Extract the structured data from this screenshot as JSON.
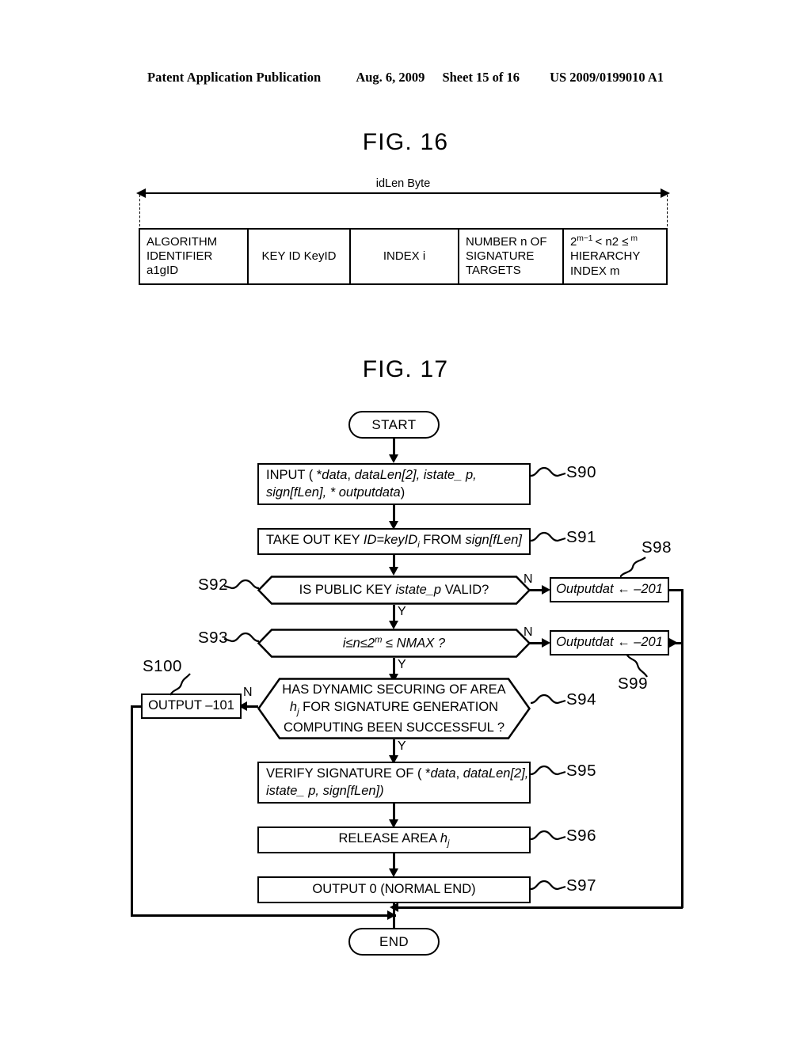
{
  "header": {
    "publication": "Patent Application Publication",
    "date": "Aug. 6, 2009",
    "sheet": "Sheet 15 of 16",
    "number": "US 2009/0199010 A1"
  },
  "fig16": {
    "title": "FIG. 16",
    "dimension_label": "idLen Byte",
    "cells": [
      {
        "name": "algorithm-identifier",
        "lines": [
          "ALGORITHM",
          "IDENTIFIER",
          "a1gID"
        ]
      },
      {
        "name": "key-id",
        "lines": [
          "KEY ID KeyID"
        ]
      },
      {
        "name": "index-i",
        "lines": [
          "INDEX i"
        ]
      },
      {
        "name": "number-of-signature-targets",
        "lines": [
          "NUMBER n OF",
          "SIGNATURE",
          "TARGETS"
        ]
      },
      {
        "name": "hierarchy-index",
        "lines": [
          "2m-1 < n2 ≤ m",
          "HIERARCHY",
          "INDEX m"
        ]
      }
    ],
    "hierarchy_expr": {
      "base": "2",
      "sup1": "m−1",
      "mid": "< n2 ≤",
      "sup2": "m"
    }
  },
  "fig17": {
    "title": "FIG. 17",
    "start_label": "START",
    "end_label": "END",
    "nodes": [
      {
        "id": "S90",
        "type": "process",
        "lines": [
          "INPUT ( * data, dataLen[2], istate_ p,",
          "sign[fLen],  * outputdata)"
        ]
      },
      {
        "id": "S91",
        "type": "process",
        "lines": [
          "TAKE OUT KEY ID=keyIDi FROM sign[fLen]"
        ]
      },
      {
        "id": "S92",
        "type": "decision",
        "lines": [
          "IS PUBLIC KEY istate_p VALID?"
        ]
      },
      {
        "id": "S93",
        "type": "decision",
        "lines": [
          "i≤n≤2m ≤ NMAX ?"
        ]
      },
      {
        "id": "S94",
        "type": "decision",
        "lines": [
          "HAS DYNAMIC  SECURING  OF  AREA",
          "hj   FOR   SIGNATURE   GENERATION",
          "COMPUTING BEEN SUCCESSFUL ?"
        ]
      },
      {
        "id": "S95",
        "type": "process",
        "lines": [
          "VERIFY SIGNATURE OF ( * data, dataLen[2],",
          "istate_ p, sign[fLen])"
        ]
      },
      {
        "id": "S96",
        "type": "process",
        "lines": [
          "RELEASE AREA hj"
        ]
      },
      {
        "id": "S97",
        "type": "process",
        "lines": [
          "OUTPUT 0 (NORMAL END)"
        ]
      },
      {
        "id": "S98",
        "type": "process",
        "lines": [
          "Outputdat ← –201"
        ]
      },
      {
        "id": "S99",
        "type": "process",
        "lines": [
          "Outputdat ← –201"
        ]
      },
      {
        "id": "S100",
        "type": "process",
        "lines": [
          "OUTPUT –101"
        ]
      }
    ],
    "labels": {
      "s90": "S90",
      "s91": "S91",
      "s92": "S92",
      "s93": "S93",
      "s94": "S94",
      "s95": "S95",
      "s96": "S96",
      "s97": "S97",
      "s98": "S98",
      "s99": "S99",
      "s100": "S100"
    },
    "branches": {
      "yes": "Y",
      "no": "N"
    },
    "text": {
      "s90_l1_a": "INPUT ( *",
      "s90_l1_b": "data",
      "s90_l1_c": ", ",
      "s90_l1_d": "dataLen",
      "s90_l1_e": "[2], ",
      "s90_l1_f": "istate_",
      "s90_l1_g": " p,",
      "s90_l2_a": "sign",
      "s90_l2_b": "[fLen],  *",
      "s90_l2_c": " outputdata",
      "s90_l2_d": ")",
      "s91_a": "TAKE OUT KEY ",
      "s91_b": "ID=keyID",
      "s91_sub": "i",
      "s91_c": " FROM ",
      "s91_d": "sign[fLen]",
      "s92_a": "IS PUBLIC KEY ",
      "s92_b": "istate_p",
      "s92_c": " VALID?",
      "s93_a": "i≤n≤2",
      "s93_sup": "m",
      "s93_b": " ≤ NMAX ?",
      "s94_l1": "HAS DYNAMIC  SECURING  OF  AREA",
      "s94_l2_a": "h",
      "s94_l2_sub": "j",
      "s94_l2_b": "  FOR   SIGNATURE   GENERATION",
      "s94_l3": "COMPUTING BEEN SUCCESSFUL ?",
      "s95_l1_a": "VERIFY SIGNATURE OF ( *",
      "s95_l1_b": "data",
      "s95_l1_c": ", ",
      "s95_l1_d": "dataLen",
      "s95_l1_e": "[2],",
      "s95_l2_a": "istate_",
      "s95_l2_b": " p, ",
      "s95_l2_c": "sign",
      "s95_l2_d": "[fLen])",
      "s96_a": "RELEASE AREA ",
      "s96_b": "h",
      "s96_sub": "j",
      "s97": "OUTPUT 0 (NORMAL END)",
      "s98": "Outputdat ← –201",
      "s99": "Outputdat ← –201",
      "s100": "OUTPUT –101"
    }
  }
}
